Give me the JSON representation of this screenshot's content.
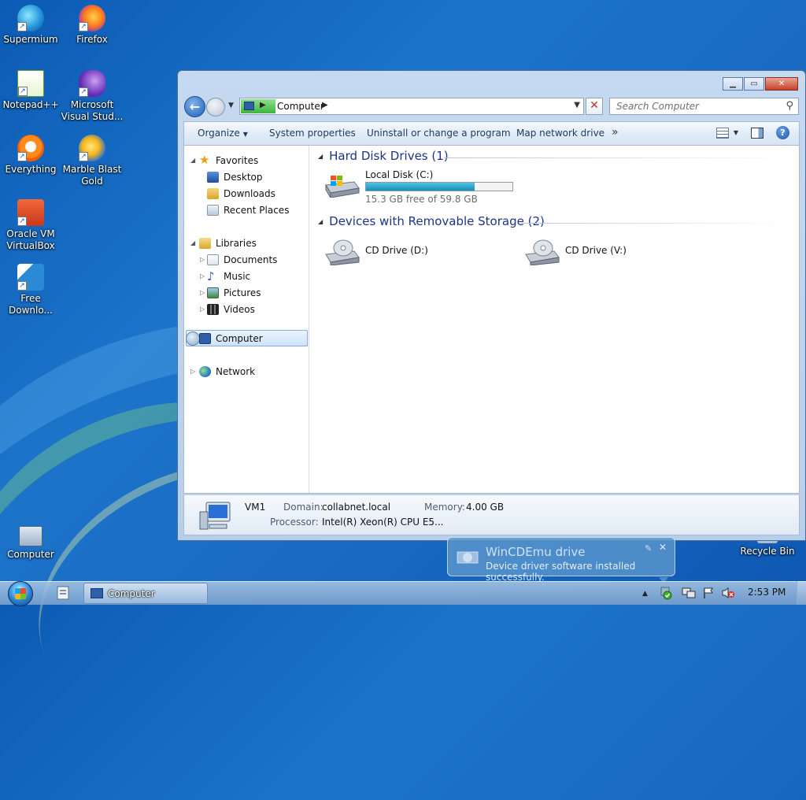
{
  "desktop": {
    "icons": [
      {
        "label": "Supermium"
      },
      {
        "label": "Firefox"
      },
      {
        "label": "Notepad++"
      },
      {
        "label": "Microsoft Visual Stud..."
      },
      {
        "label": "Everything"
      },
      {
        "label": "Marble Blast Gold"
      },
      {
        "label": "Oracle VM VirtualBox"
      },
      {
        "label": "Free Downlo..."
      },
      {
        "label": "Computer"
      },
      {
        "label": "Recycle Bin"
      }
    ]
  },
  "window": {
    "address": {
      "crumb": "Computer"
    },
    "search": {
      "placeholder": "Search Computer"
    },
    "toolbar": {
      "organize": "Organize",
      "system_properties": "System properties",
      "uninstall": "Uninstall or change a program",
      "map_drive": "Map network drive",
      "more": "»"
    },
    "nav": {
      "favorites": "Favorites",
      "desktop": "Desktop",
      "downloads": "Downloads",
      "recent": "Recent Places",
      "libraries": "Libraries",
      "documents": "Documents",
      "music": "Music",
      "pictures": "Pictures",
      "videos": "Videos",
      "computer": "Computer",
      "network": "Network"
    },
    "groups": {
      "hdd_title": "Hard Disk Drives (1)",
      "removable_title": "Devices with Removable Storage (2)"
    },
    "drives": {
      "c": {
        "name": "Local Disk (C:)",
        "free": "15.3 GB free of 59.8 GB",
        "used_fraction": 0.744
      },
      "d": {
        "name": "CD Drive (D:)"
      },
      "v": {
        "name": "CD Drive (V:)"
      }
    },
    "details": {
      "name": "VM1",
      "domain_label": "Domain:",
      "domain_value": "collabnet.local",
      "memory_label": "Memory:",
      "memory_value": "4.00 GB",
      "processor_label": "Processor:",
      "processor_value": "Intel(R) Xeon(R) CPU E5..."
    }
  },
  "taskbar": {
    "task_label": "Computer",
    "clock": "2:53 PM"
  },
  "notification": {
    "title": "WinCDEmu drive",
    "text": "Device driver software installed successfully."
  }
}
